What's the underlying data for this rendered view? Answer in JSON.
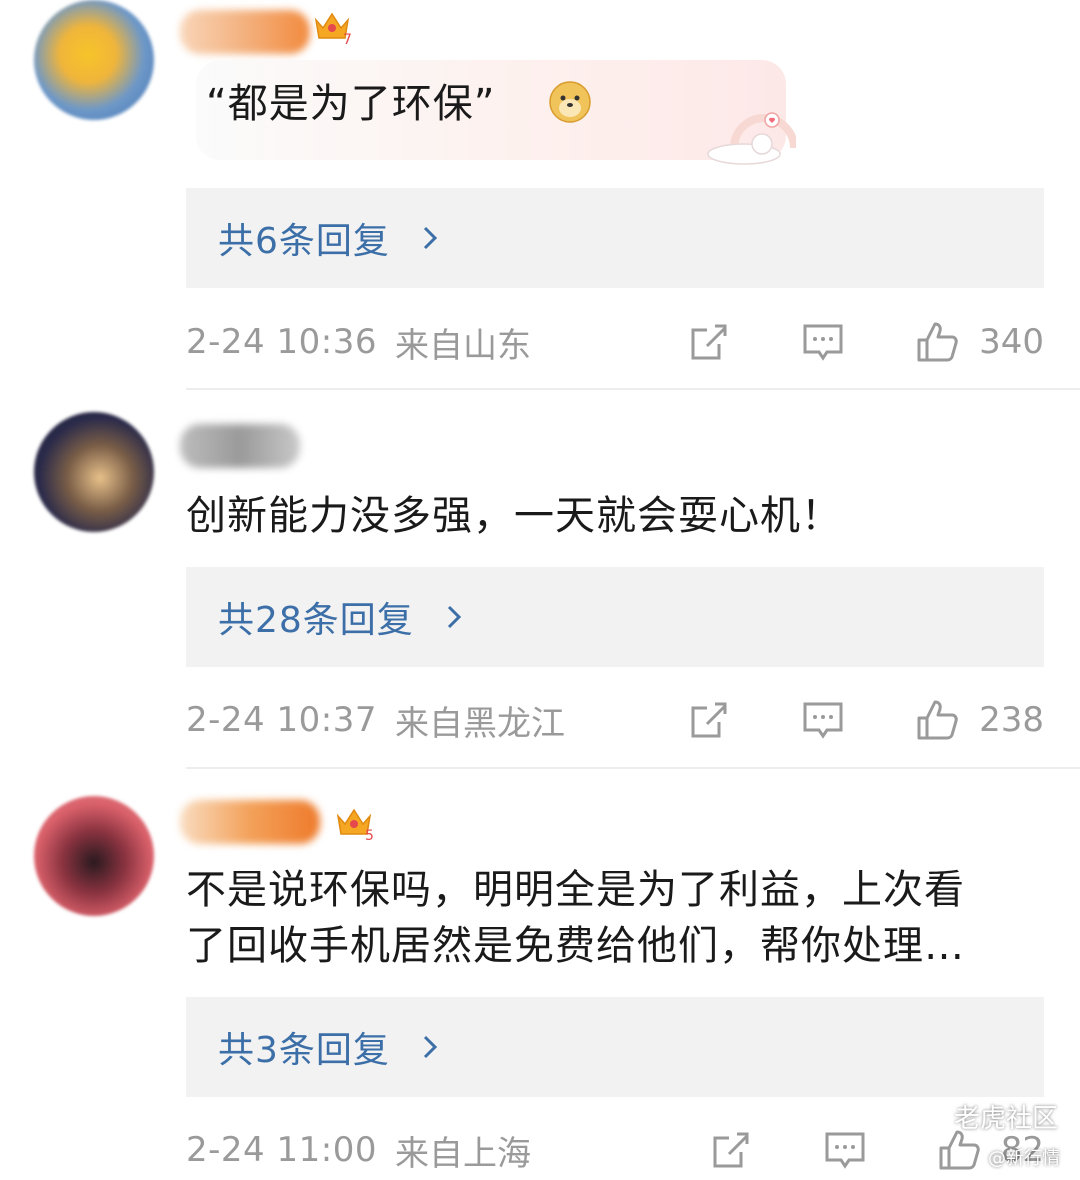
{
  "comments": [
    {
      "text": "“都是为了环保”",
      "replies_label": "共6条回复",
      "date": "2-24  10:36",
      "location": "来自山东",
      "likes": "340",
      "badge_level": "7"
    },
    {
      "text": "创新能力没多强，一天就会耍心机！",
      "replies_label": "共28条回复",
      "date": "2-24  10:37",
      "location": "来自黑龙江",
      "likes": "238"
    },
    {
      "text_line1": "不是说环保吗，明明全是为了利益，上次看",
      "text_line2": "了回收手机居然是免费给他们，帮你处理…",
      "replies_label": "共3条回复",
      "date": "2-24  11:00",
      "location": "来自上海",
      "likes": "82",
      "badge_level": "5"
    }
  ],
  "watermark": {
    "main": "老虎社区",
    "sub": "@新行情"
  },
  "colors": {
    "link_blue": "#3c6fa8",
    "meta_gray": "#9a9a9a",
    "reply_bg": "#f2f2f2"
  },
  "icons": [
    "chevron-right-icon",
    "share-icon",
    "comment-icon",
    "thumbs-up-icon",
    "level-crown-icon",
    "doge-emoji-icon",
    "cat-sticker-icon"
  ]
}
